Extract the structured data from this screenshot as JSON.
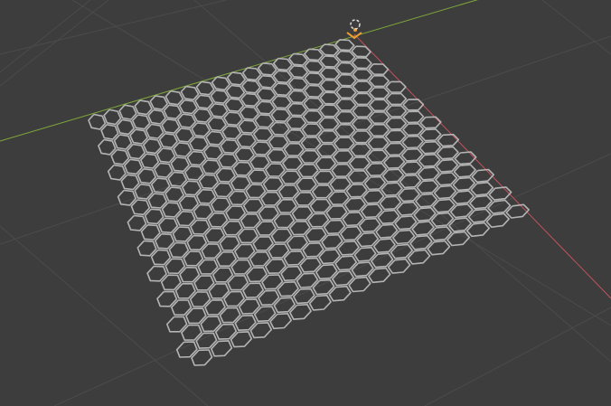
{
  "viewport": {
    "background": "#3d3d3d",
    "floor_grid_color": "#4b4b4b",
    "x_axis_color": "#c0525e",
    "y_axis_color": "#7fa83a",
    "mesh_wire_color": "#b4b4b4",
    "selection_color": "#f0a030",
    "hex_columns": 17,
    "hex_rows": 20
  }
}
